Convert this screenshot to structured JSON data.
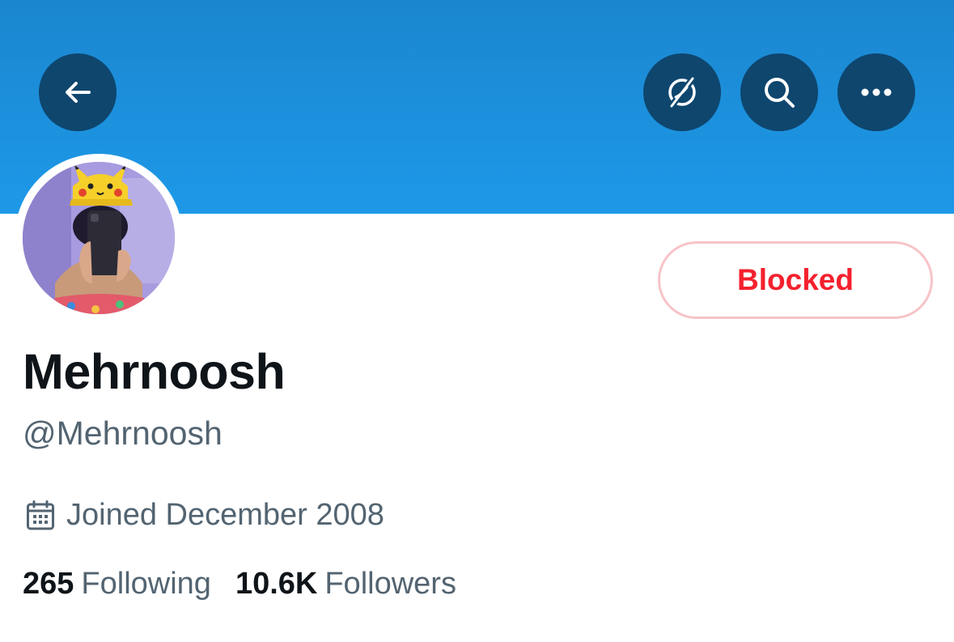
{
  "header": {
    "back_icon": "arrow-left-icon",
    "translate_icon": "translate-icon",
    "search_icon": "search-icon",
    "more_icon": "more-horizontal-icon",
    "banner_color": "#1d9bf0",
    "button_bg": "#0e466e"
  },
  "profile": {
    "display_name": "Mehrnoosh",
    "handle": "@Mehrnoosh",
    "joined": "Joined December 2008",
    "joined_icon": "calendar-icon",
    "avatar": "avatar-photo"
  },
  "actions": {
    "blocked_label": "Blocked",
    "blocked_color": "#f4212e"
  },
  "stats": {
    "following_count": "265",
    "following_label": "Following",
    "followers_count": "10.6K",
    "followers_label": "Followers"
  }
}
